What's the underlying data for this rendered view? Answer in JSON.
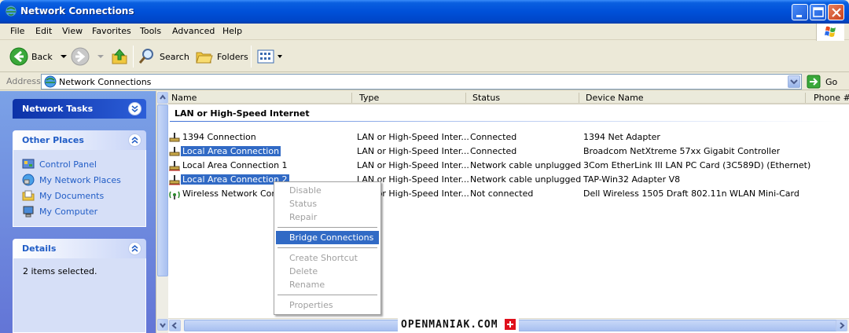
{
  "window": {
    "title": "Network Connections"
  },
  "menu": [
    "File",
    "Edit",
    "View",
    "Favorites",
    "Tools",
    "Advanced",
    "Help"
  ],
  "toolbar": {
    "back_label": "Back",
    "search_label": "Search",
    "folders_label": "Folders"
  },
  "address": {
    "label": "Address",
    "value": "Network Connections",
    "go_label": "Go"
  },
  "left": {
    "network_tasks_title": "Network Tasks",
    "other_places_title": "Other Places",
    "other_places": [
      "Control Panel",
      "My Network Places",
      "My Documents",
      "My Computer"
    ],
    "details_title": "Details",
    "details_text": "2 items selected."
  },
  "columns": [
    "Name",
    "Type",
    "Status",
    "Device Name",
    "Phone #"
  ],
  "group_title": "LAN or High-Speed Internet",
  "rows": [
    {
      "name": "1394 Connection",
      "type": "LAN or High-Speed Inter...",
      "status": "Connected",
      "device": "1394 Net Adapter"
    },
    {
      "name": "Local Area Connection",
      "type": "LAN or High-Speed Inter...",
      "status": "Connected",
      "device": "Broadcom NetXtreme 57xx Gigabit Controller"
    },
    {
      "name": "Local Area Connection 1",
      "type": "LAN or High-Speed Inter...",
      "status": "Network cable unplugged",
      "device": "3Com EtherLink III LAN PC Card (3C589D) (Ethernet)"
    },
    {
      "name": "Local Area Connection 2",
      "type": "LAN or High-Speed Inter...",
      "status": "Network cable unplugged",
      "device": "TAP-Win32 Adapter V8"
    },
    {
      "name": "Wireless Network Connection",
      "type": "LAN or High-Speed Inter...",
      "status": "Not connected",
      "device": "Dell Wireless 1505 Draft 802.11n WLAN Mini-Card"
    }
  ],
  "context_menu": {
    "disable": "Disable",
    "status": "Status",
    "repair": "Repair",
    "bridge": "Bridge Connections",
    "create_shortcut": "Create Shortcut",
    "delete": "Delete",
    "rename": "Rename",
    "properties": "Properties"
  },
  "watermark": "OPENMANIAK.COM",
  "colors": {
    "selection": "#316ac5",
    "title_bar": "#0050d8",
    "task_pane": "#7ba2e7",
    "link": "#215dc6"
  }
}
